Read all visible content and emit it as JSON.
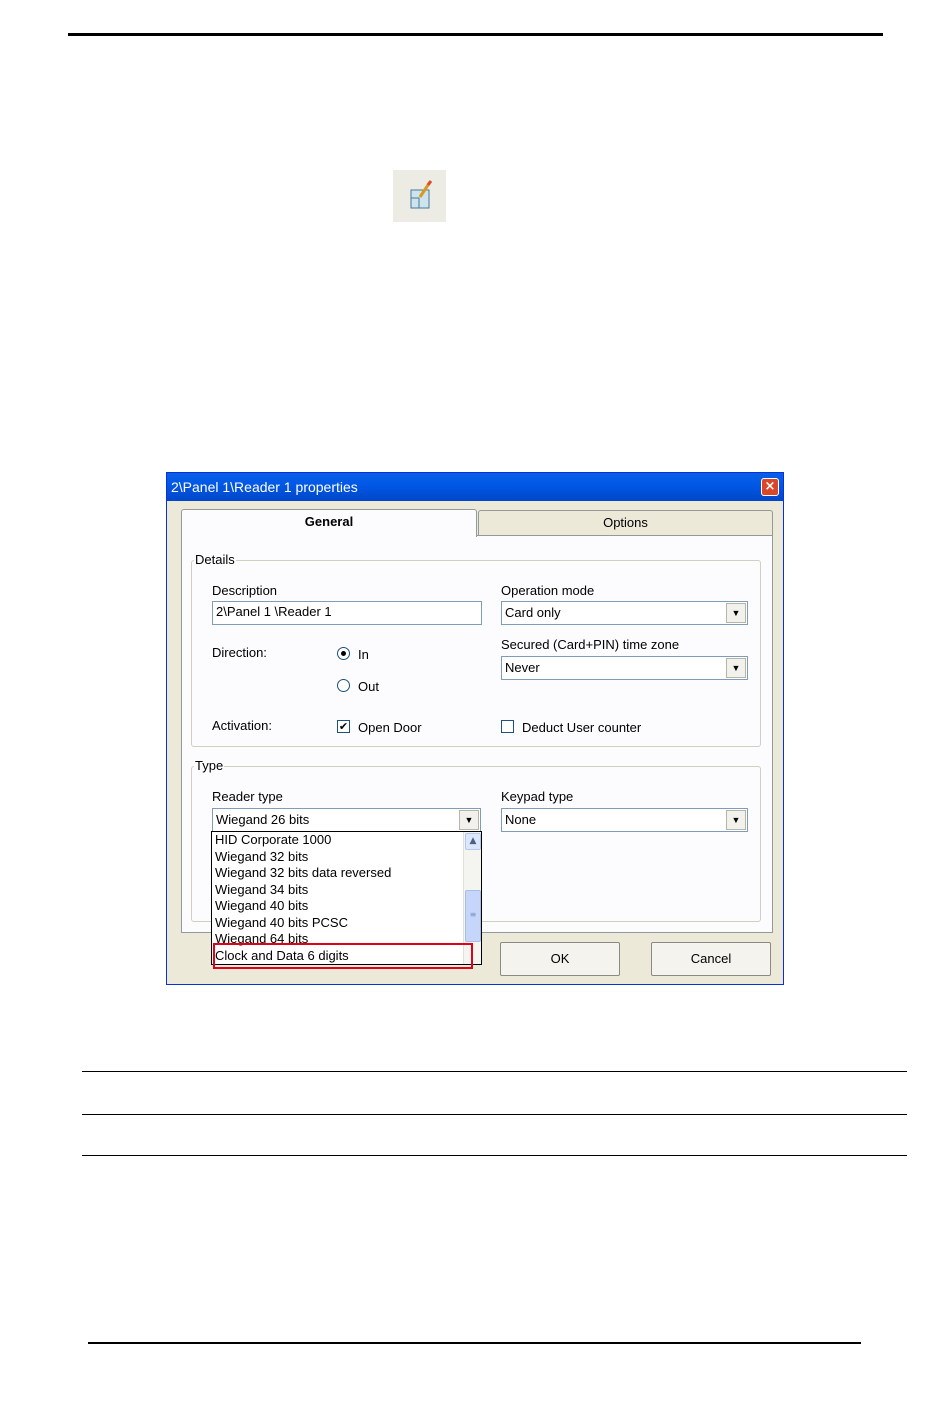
{
  "dialog": {
    "title": "2\\Panel 1\\Reader 1 properties",
    "close_glyph": "×",
    "tabs": [
      {
        "label": "General",
        "active": true
      },
      {
        "label": "Options",
        "active": false
      }
    ],
    "details": {
      "group_label": "Details",
      "description_label": "Description",
      "description_value": "2\\Panel 1 \\Reader 1",
      "operation_mode_label": "Operation mode",
      "operation_mode_value": "Card only",
      "direction_label": "Direction:",
      "direction_in": "In",
      "direction_out": "Out",
      "direction_selected": "In",
      "secured_label": "Secured (Card+PIN)  time zone",
      "secured_value": "Never",
      "activation_label": "Activation:",
      "open_door_label": "Open Door",
      "open_door_checked": true,
      "deduct_label": "Deduct User counter",
      "deduct_checked": false
    },
    "type": {
      "group_label": "Type",
      "reader_type_label": "Reader type",
      "reader_type_value": "Wiegand 26 bits",
      "keypad_type_label": "Keypad type",
      "keypad_type_value": "None",
      "reader_type_options": [
        "HID Corporate 1000",
        "Wiegand 32 bits",
        "Wiegand 32 bits data reversed",
        "Wiegand 34 bits",
        "Wiegand 40 bits",
        "Wiegand 40 bits PCSC",
        "Wiegand 64 bits",
        "Clock and Data 6 digits"
      ],
      "highlighted_option": "Clock and Data 6 digits"
    },
    "buttons": {
      "ok": "OK",
      "cancel": "Cancel"
    }
  },
  "colors": {
    "titlebar": "#0054e3",
    "dialog_bg": "#ece9d8",
    "highlight_box": "#e1001a"
  },
  "icons": {
    "toolbar_icon": "edit-properties-icon",
    "dropdown_arrow": "▼",
    "scroll_up": "▲",
    "check_mark": "✔"
  }
}
